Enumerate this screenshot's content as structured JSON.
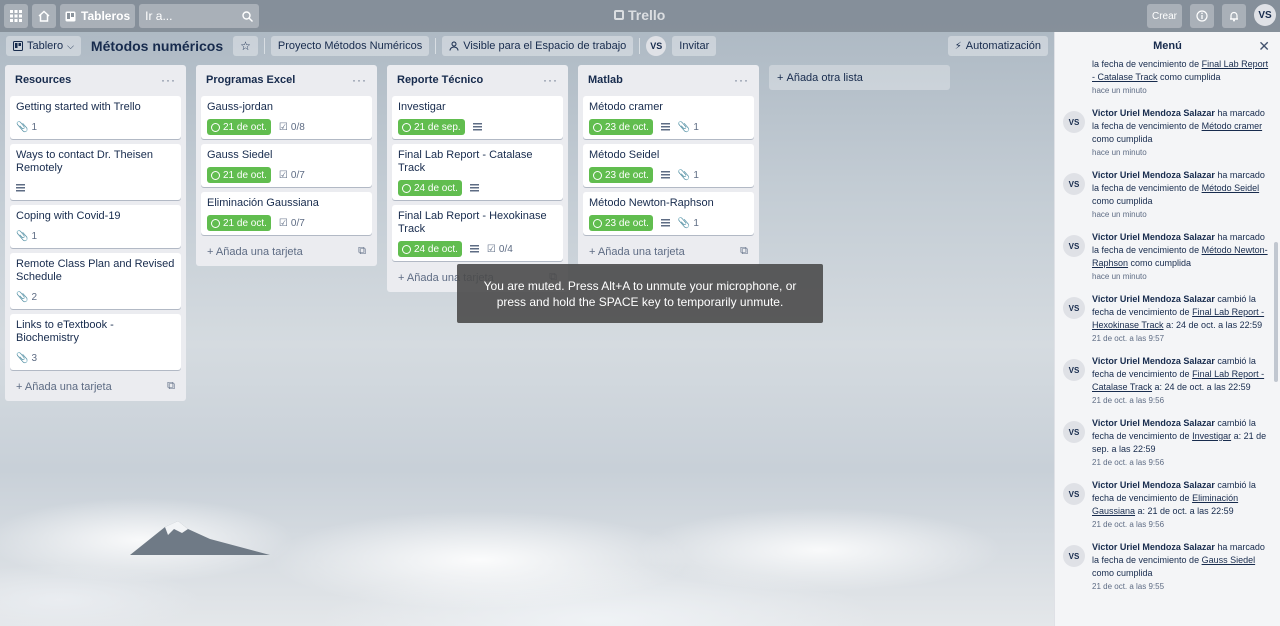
{
  "topbar": {
    "boards_label": "Tableros",
    "search_placeholder": "Ir a...",
    "logo": "Trello",
    "create_label": "Crear",
    "avatar": "VS"
  },
  "board": {
    "view_label": "Tablero",
    "title": "Métodos numéricos",
    "team_label": "Proyecto Métodos Numéricos",
    "visibility_label": "Visible para el Espacio de trabajo",
    "avatar": "VS",
    "invite_label": "Invitar",
    "automation_label": "Automatización"
  },
  "lists": [
    {
      "title": "Resources",
      "add_label": "Añada una tarjeta",
      "cards": [
        {
          "title": "Getting started with Trello",
          "attachments": "1"
        },
        {
          "title": "Ways to contact Dr. Theisen Remotely",
          "description": true
        },
        {
          "title": "Coping with Covid-19",
          "attachments": "1"
        },
        {
          "title": "Remote Class Plan and Revised Schedule",
          "attachments": "2"
        },
        {
          "title": "Links to eTextbook - Biochemistry",
          "attachments": "3"
        }
      ]
    },
    {
      "title": "Programas Excel",
      "add_label": "Añada una tarjeta",
      "cards": [
        {
          "title": "Gauss-jordan",
          "due": "21 de oct.",
          "checklist": "0/8"
        },
        {
          "title": "Gauss Siedel",
          "due": "21 de oct.",
          "checklist": "0/7"
        },
        {
          "title": "Eliminación Gaussiana",
          "due": "21 de oct.",
          "checklist": "0/7"
        }
      ]
    },
    {
      "title": "Reporte Técnico",
      "add_label": "Añada una tarjeta",
      "cards": [
        {
          "title": "Investigar",
          "due": "21 de sep.",
          "description": true
        },
        {
          "title": "Final Lab Report - Catalase Track",
          "due": "24 de oct.",
          "description": true
        },
        {
          "title": "Final Lab Report - Hexokinase Track",
          "due": "24 de oct.",
          "description": true,
          "checklist": "0/4"
        }
      ]
    },
    {
      "title": "Matlab",
      "add_label": "Añada una tarjeta",
      "cards": [
        {
          "title": "Método cramer",
          "due": "23 de oct.",
          "description": true,
          "attachments": "1"
        },
        {
          "title": "Método Seidel",
          "due": "23 de oct.",
          "description": true,
          "attachments": "1"
        },
        {
          "title": "Método Newton-Raphson",
          "due": "23 de oct.",
          "description": true,
          "attachments": "1"
        }
      ]
    }
  ],
  "add_list_label": "Añada otra lista",
  "toast": "You are muted. Press Alt+A to unmute your microphone, or press and hold the SPACE key to temporarily unmute.",
  "menu": {
    "title": "Menú",
    "activities": [
      {
        "pre": "",
        "user": "",
        "action": "la fecha de vencimiento de ",
        "link": "Final Lab Report - Catalase Track",
        "post": " como cumplida",
        "time": "hace un minuto",
        "partial": true
      },
      {
        "user": "Victor Uriel Mendoza Salazar",
        "action": " ha marcado la fecha de vencimiento de ",
        "link": "Método cramer",
        "post": " como cumplida",
        "time": "hace un minuto"
      },
      {
        "user": "Victor Uriel Mendoza Salazar",
        "action": " ha marcado la fecha de vencimiento de ",
        "link": "Método Seidel",
        "post": " como cumplida",
        "time": "hace un minuto"
      },
      {
        "user": "Victor Uriel Mendoza Salazar",
        "action": " ha marcado la fecha de vencimiento de ",
        "link": "Método Newton-Raphson",
        "post": " como cumplida",
        "time": "hace un minuto"
      },
      {
        "user": "Victor Uriel Mendoza Salazar",
        "action": " cambió la fecha de vencimiento de ",
        "link": "Final Lab Report - Hexokinase Track",
        "post": " a: 24 de oct. a las 22:59",
        "time": "21 de oct. a las 9:57"
      },
      {
        "user": "Victor Uriel Mendoza Salazar",
        "action": " cambió la fecha de vencimiento de ",
        "link": "Final Lab Report - Catalase Track",
        "post": " a: 24 de oct. a las 22:59",
        "time": "21 de oct. a las 9:56"
      },
      {
        "user": "Victor Uriel Mendoza Salazar",
        "action": " cambió la fecha de vencimiento de ",
        "link": "Investigar",
        "post": " a: 21 de sep. a las 22:59",
        "time": "21 de oct. a las 9:56"
      },
      {
        "user": "Victor Uriel Mendoza Salazar",
        "action": " cambió la fecha de vencimiento de ",
        "link": "Eliminación Gaussiana",
        "post": " a: 21 de oct. a las 22:59",
        "time": "21 de oct. a las 9:56"
      },
      {
        "user": "Victor Uriel Mendoza Salazar",
        "action": " ha marcado la fecha de vencimiento de ",
        "link": "Gauss Siedel",
        "post": " como cumplida",
        "time": "21 de oct. a las 9:55"
      }
    ]
  }
}
